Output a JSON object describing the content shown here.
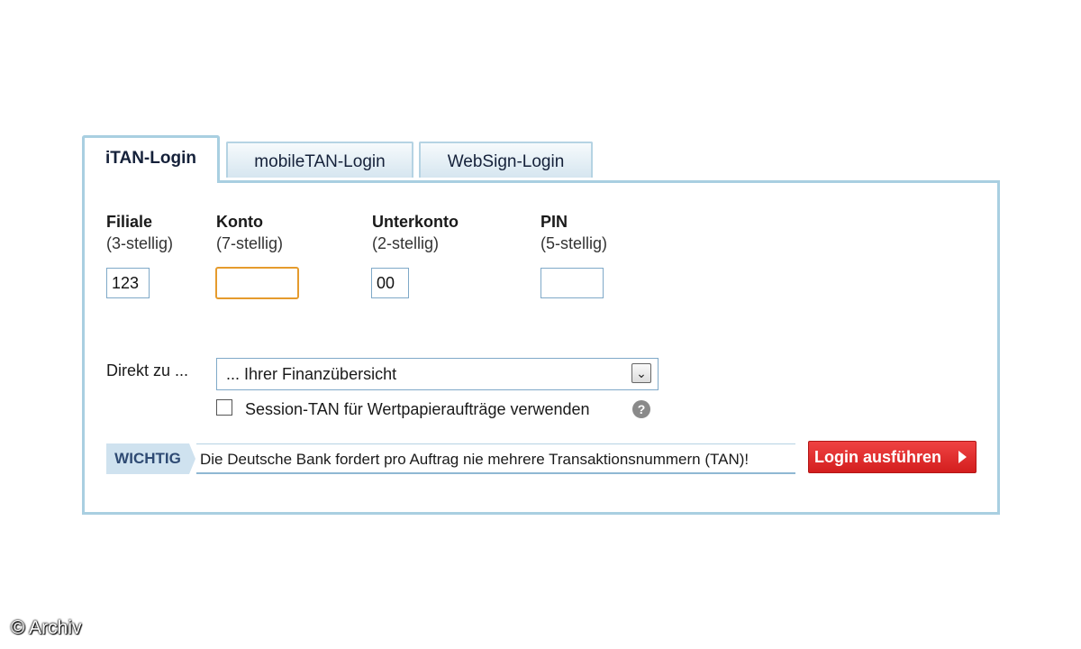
{
  "tabs": [
    {
      "label": "iTAN-Login",
      "active": true
    },
    {
      "label": "mobileTAN-Login",
      "active": false
    },
    {
      "label": "WebSign-Login",
      "active": false
    }
  ],
  "fields": {
    "filiale": {
      "label": "Filiale",
      "hint": "(3-stellig)",
      "value": "123"
    },
    "konto": {
      "label": "Konto",
      "hint": "(7-stellig)",
      "value": ""
    },
    "unterkonto": {
      "label": "Unterkonto",
      "hint": "(2-stellig)",
      "value": "00"
    },
    "pin": {
      "label": "PIN",
      "hint": "(5-stellig)",
      "value": ""
    }
  },
  "direkt": {
    "label": "Direkt zu ...",
    "selected": "... Ihrer Finanzübersicht"
  },
  "session_tan": {
    "label": "Session-TAN für Wertpapieraufträge verwenden",
    "checked": false,
    "help_icon": "question-icon"
  },
  "notice": {
    "badge": "WICHTIG",
    "text": "Die Deutsche Bank fordert pro Auftrag nie mehrere Transaktionsnummern (TAN)!"
  },
  "login_button": "Login ausführen",
  "copyright": "© Archiv",
  "colors": {
    "tab_border": "#a9cfe1",
    "focus_border": "#e59b2d",
    "login_red": "#d31e1e",
    "notice_badge_bg": "#cfe2ef"
  }
}
